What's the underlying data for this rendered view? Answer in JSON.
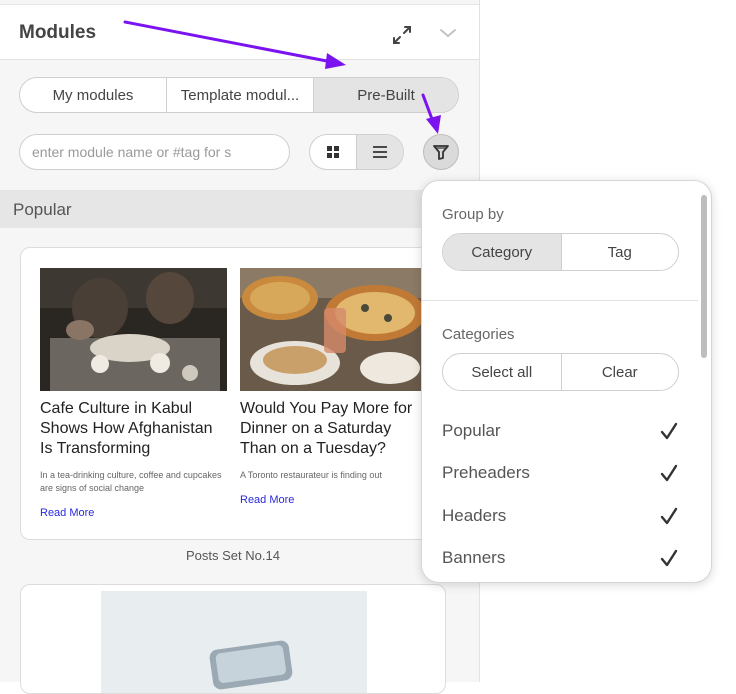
{
  "panel": {
    "title": "Modules",
    "tabs": [
      {
        "label": "My modules",
        "active": false
      },
      {
        "label": "Template modul...",
        "active": false
      },
      {
        "label": "Pre-Built",
        "active": true
      }
    ],
    "search": {
      "placeholder": "enter module name or #tag for s",
      "value": ""
    },
    "view_mode": "list",
    "section": "Popular",
    "card": {
      "posts": [
        {
          "title": "Cafe Culture in Kabul Shows How Afghanistan Is Transforming",
          "excerpt": "In a tea-drinking culture, coffee and cupcakes are signs of social change",
          "link": "Read More"
        },
        {
          "title": "Would You Pay More for Dinner on a Saturday Than on a Tuesday?",
          "excerpt": "A Toronto restaurateur is finding out",
          "link": "Read More"
        }
      ],
      "caption": "Posts Set No.14"
    }
  },
  "filter": {
    "group_by_label": "Group by",
    "group_by": [
      {
        "label": "Category",
        "active": true
      },
      {
        "label": "Tag",
        "active": false
      }
    ],
    "categories_label": "Categories",
    "select_all": "Select all",
    "clear": "Clear",
    "categories": [
      {
        "label": "Popular",
        "checked": true
      },
      {
        "label": "Preheaders",
        "checked": true
      },
      {
        "label": "Headers",
        "checked": true
      },
      {
        "label": "Banners",
        "checked": true
      }
    ]
  },
  "colors": {
    "annotation_arrow": "#7b12f0",
    "link": "#2a2adc",
    "active_segment": "#e4e4e4"
  },
  "icons": [
    "expand-icon",
    "chevron-down-icon",
    "grid-icon",
    "list-icon",
    "filter-funnel-icon",
    "checkmark-icon"
  ]
}
